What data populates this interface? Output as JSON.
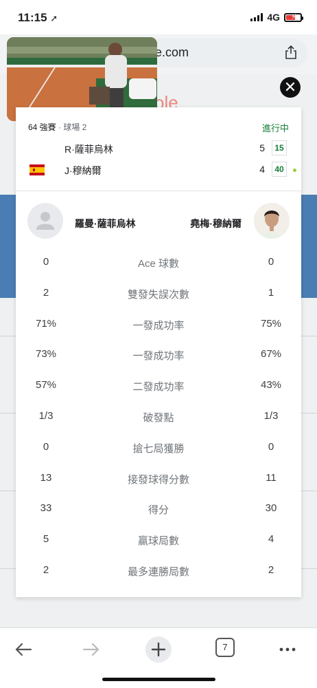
{
  "status_bar": {
    "time": "11:15",
    "network": "4G"
  },
  "browser": {
    "url_suffix": "e.com"
  },
  "background": {
    "logo_text": "ole"
  },
  "match": {
    "round": "64 強賽",
    "court": " · 球場 2",
    "status": "進行中",
    "players": [
      {
        "name": "R·薩菲烏林",
        "games": "5",
        "points": "15",
        "flag": "none"
      },
      {
        "name": "J·穆納爾",
        "games": "4",
        "points": "40",
        "flag": "spain",
        "serving": true
      }
    ],
    "full_names": {
      "left": "羅曼·薩菲烏林",
      "right": "堯梅·穆納爾"
    }
  },
  "stats": [
    {
      "left": "0",
      "label": "Ace 球數",
      "right": "0"
    },
    {
      "left": "2",
      "label": "雙發失誤次數",
      "right": "1"
    },
    {
      "left": "71%",
      "label": "一發成功率",
      "right": "75%"
    },
    {
      "left": "73%",
      "label": "一發成功率",
      "right": "67%"
    },
    {
      "left": "57%",
      "label": "二發成功率",
      "right": "43%"
    },
    {
      "left": "1/3",
      "label": "破發點",
      "right": "1/3"
    },
    {
      "left": "0",
      "label": "搶七局獲勝",
      "right": "0"
    },
    {
      "left": "13",
      "label": "接發球得分數",
      "right": "11"
    },
    {
      "left": "33",
      "label": "得分",
      "right": "30"
    },
    {
      "left": "5",
      "label": "贏球局數",
      "right": "4"
    },
    {
      "left": "2",
      "label": "最多連勝局數",
      "right": "2"
    }
  ],
  "toolbar": {
    "tab_count": "7"
  },
  "colors": {
    "live_green": "#188038",
    "serve_dot": "#9bcc3c",
    "bg_blue": "#4a7db3"
  }
}
